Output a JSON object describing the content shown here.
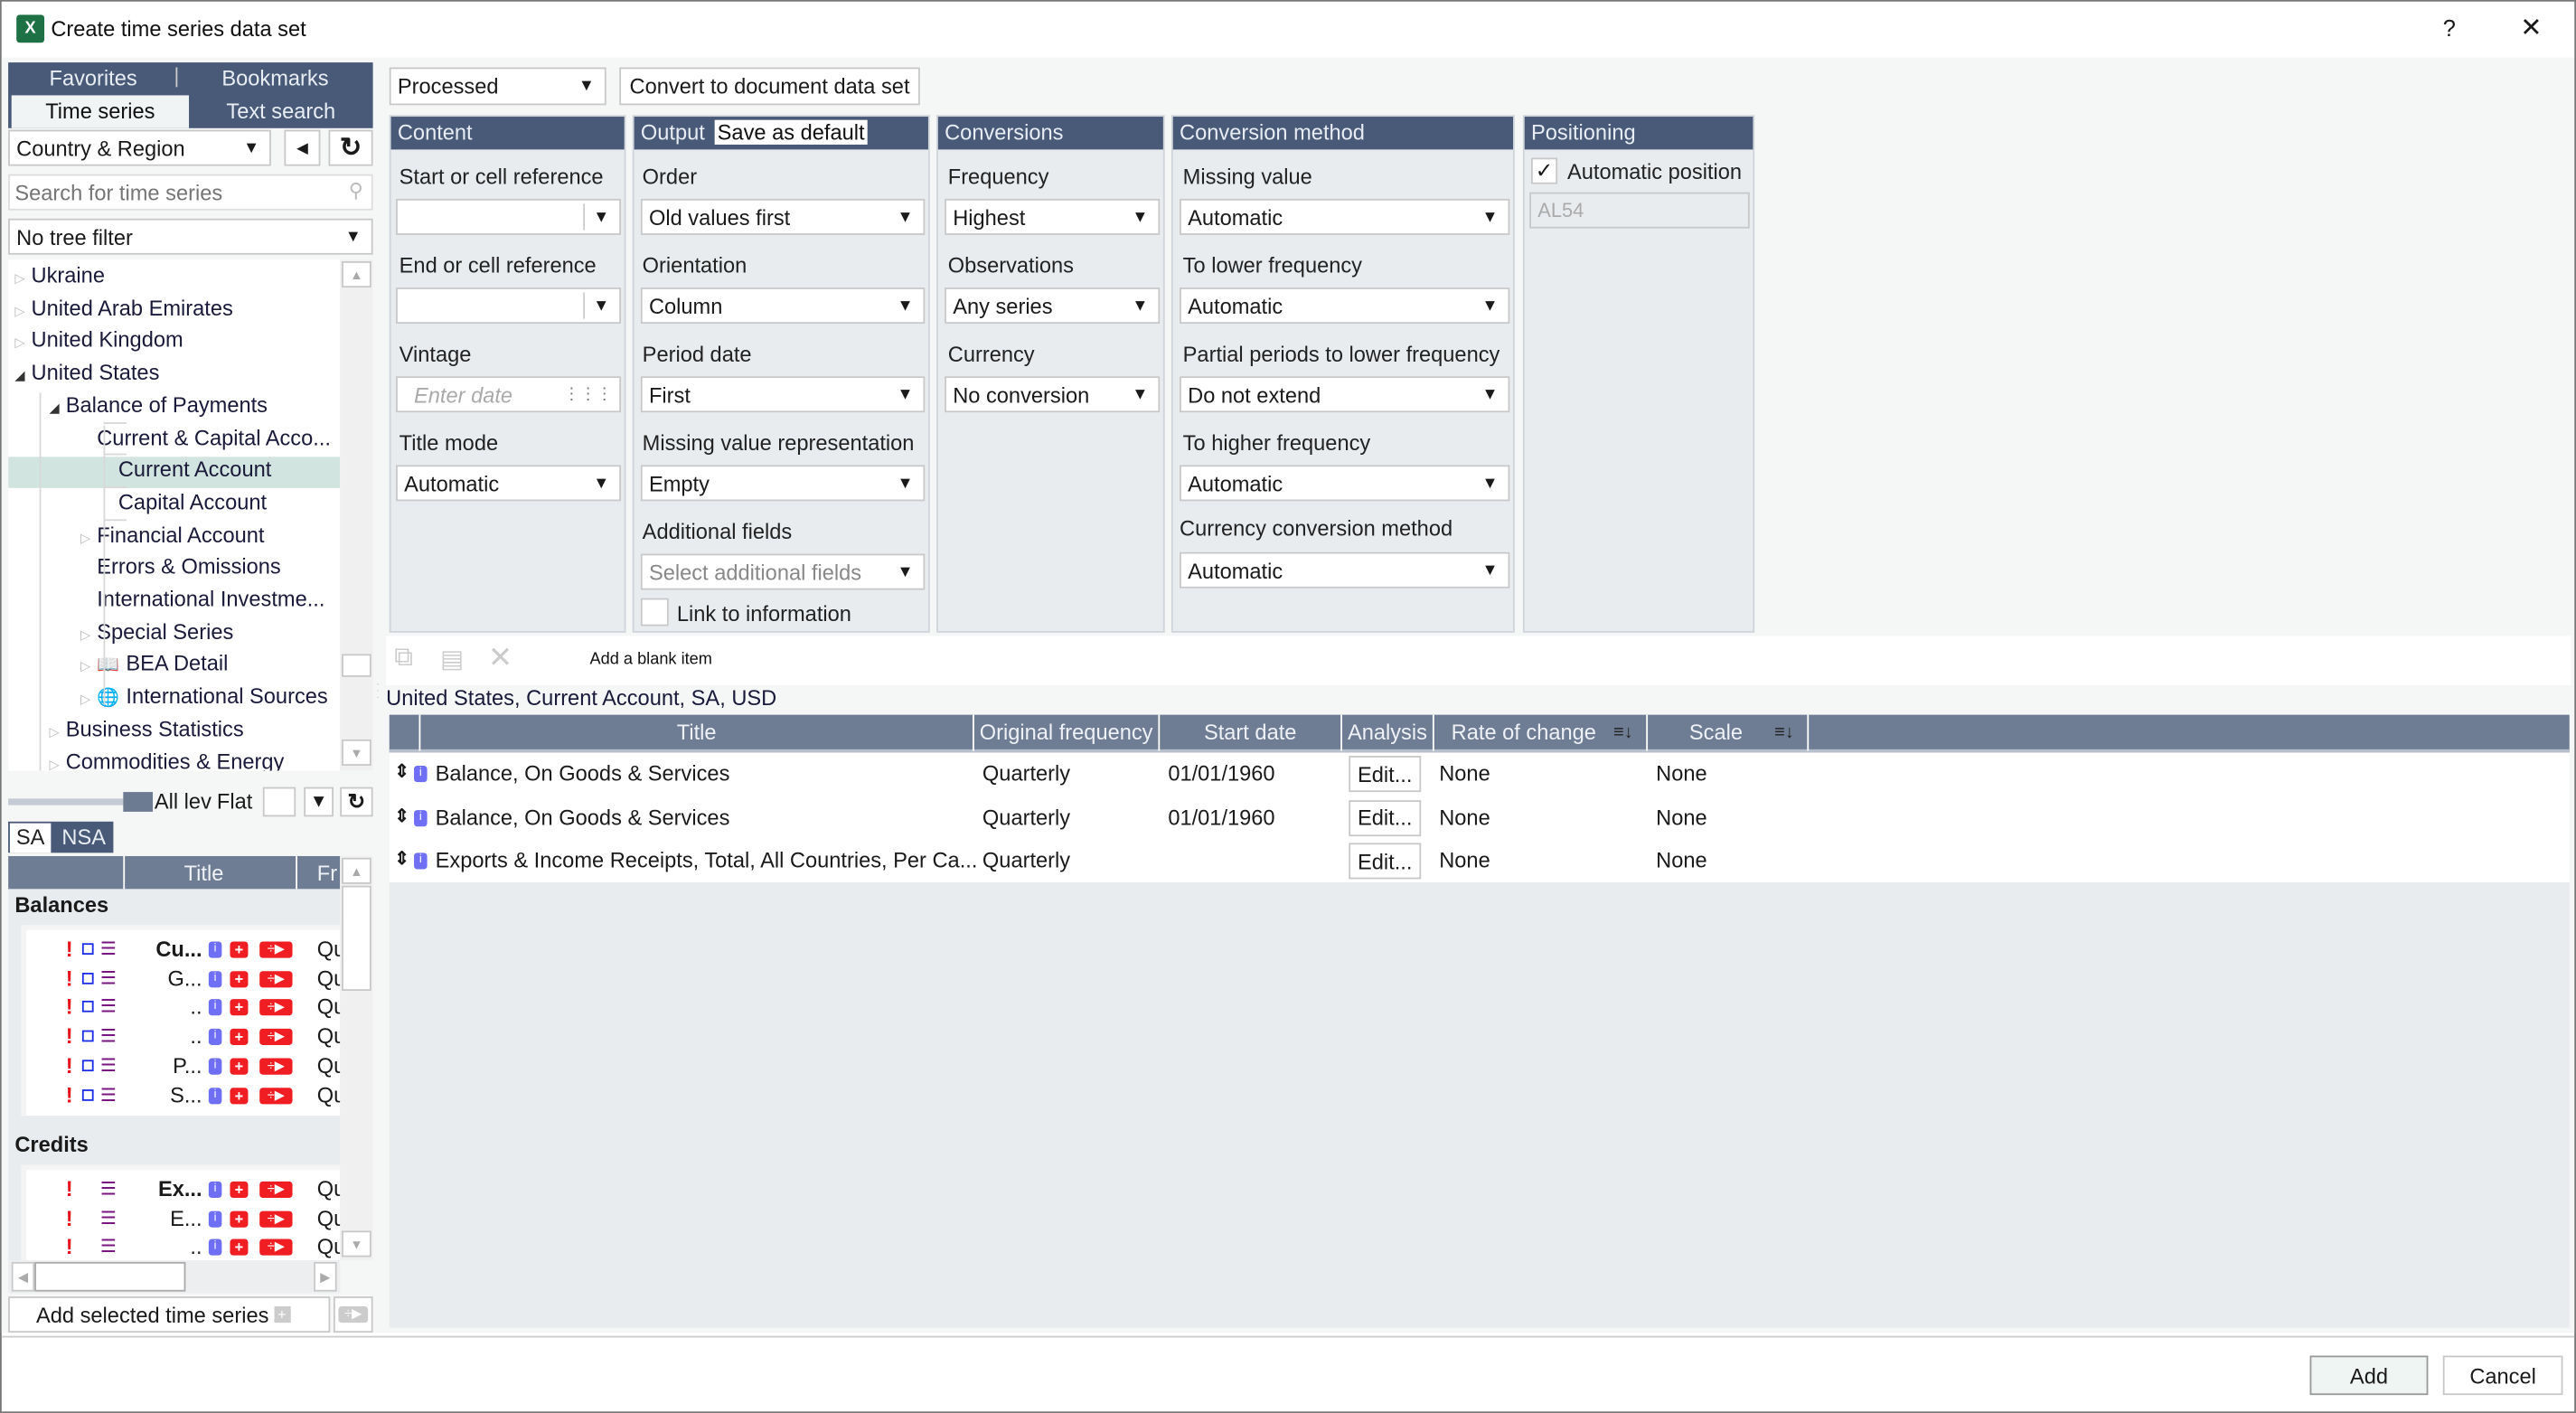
{
  "window": {
    "title": "Create time series data set",
    "app_icon": "excel-icon",
    "help_label": "?",
    "close_label": "✕"
  },
  "left": {
    "tabs_row1": [
      {
        "label": "Favorites"
      },
      {
        "label": "Bookmarks"
      }
    ],
    "tabs_row2": [
      {
        "label": "Time series",
        "active": true
      },
      {
        "label": "Text search",
        "active": false
      }
    ],
    "category_select": "Country & Region",
    "search_placeholder": "Search for time series",
    "tree_filter": "No tree filter",
    "tree": [
      {
        "label": "Ukraine",
        "level": 0,
        "expander": "collapsed"
      },
      {
        "label": "United Arab Emirates",
        "level": 0,
        "expander": "collapsed"
      },
      {
        "label": "United Kingdom",
        "level": 0,
        "expander": "collapsed"
      },
      {
        "label": "United States",
        "level": 0,
        "expander": "expanded"
      },
      {
        "label": "Balance of Payments",
        "level": 1,
        "expander": "expanded"
      },
      {
        "label": "Current & Capital Acco...",
        "level": 2,
        "expander": "none"
      },
      {
        "label": "Current Account",
        "level": 3,
        "expander": "none",
        "selected": true
      },
      {
        "label": "Capital Account",
        "level": 3,
        "expander": "none"
      },
      {
        "label": "Financial Account",
        "level": 2,
        "expander": "collapsed"
      },
      {
        "label": "Errors & Omissions",
        "level": 2,
        "expander": "none"
      },
      {
        "label": "International Investme...",
        "level": 2,
        "expander": "none"
      },
      {
        "label": "Special Series",
        "level": 2,
        "expander": "collapsed"
      },
      {
        "label": "BEA Detail",
        "level": 2,
        "expander": "collapsed",
        "icon": "book-icon"
      },
      {
        "label": "International Sources",
        "level": 2,
        "expander": "collapsed",
        "icon": "globe-icon"
      },
      {
        "label": "Business Statistics",
        "level": 1,
        "expander": "collapsed"
      },
      {
        "label": "Commodities & Energy",
        "level": 1,
        "expander": "collapsed"
      }
    ],
    "level_label": "All lev",
    "flat_label": "Flat",
    "sa_tabs": [
      {
        "label": "SA",
        "active": true
      },
      {
        "label": "NSA",
        "active": false
      }
    ],
    "series_header": {
      "title": "Title",
      "freq": "Fr"
    },
    "groups": [
      {
        "name": "Balances",
        "rows": [
          {
            "title": "Cu...",
            "bold": true,
            "freq": "Qu",
            "box": true
          },
          {
            "title": "G...",
            "freq": "Qu",
            "box": true
          },
          {
            "title": "..",
            "freq": "Qu",
            "box": true
          },
          {
            "title": "..",
            "freq": "Qu",
            "box": true
          },
          {
            "title": "P...",
            "freq": "Qu",
            "box": true
          },
          {
            "title": "S...",
            "freq": "Qu",
            "box": true
          }
        ]
      },
      {
        "name": "Credits",
        "rows": [
          {
            "title": "Ex...",
            "bold": true,
            "freq": "Qu",
            "box": false
          },
          {
            "title": "E...",
            "freq": "Qu",
            "box": false
          },
          {
            "title": "..",
            "freq": "Qu",
            "box": false
          }
        ]
      }
    ],
    "add_selected_label": "Add selected time series"
  },
  "toolbar": {
    "mode_select": "Processed",
    "convert_label": "Convert to document data set"
  },
  "panels": {
    "content": {
      "title": "Content",
      "start_label": "Start or cell reference",
      "start_value": "",
      "end_label": "End or cell reference",
      "end_value": "",
      "vintage_label": "Vintage",
      "vintage_placeholder": "Enter date",
      "title_mode_label": "Title mode",
      "title_mode_value": "Automatic"
    },
    "output": {
      "title": "Output",
      "save_default_label": "Save as default",
      "order_label": "Order",
      "order_value": "Old values first",
      "orientation_label": "Orientation",
      "orientation_value": "Column",
      "period_label": "Period date",
      "period_value": "First",
      "missing_label": "Missing value representation",
      "missing_value": "Empty",
      "additional_label": "Additional fields",
      "additional_placeholder": "Select additional fields",
      "link_label": "Link to information",
      "link_checked": false
    },
    "conversions": {
      "title": "Conversions",
      "frequency_label": "Frequency",
      "frequency_value": "Highest",
      "observations_label": "Observations",
      "observations_value": "Any series",
      "currency_label": "Currency",
      "currency_value": "No conversion"
    },
    "method": {
      "title": "Conversion method",
      "missing_label": "Missing value",
      "missing_value": "Automatic",
      "lower_label": "To lower frequency",
      "lower_value": "Automatic",
      "partial_label": "Partial periods to lower frequency",
      "partial_value": "Do not extend",
      "higher_label": "To higher frequency",
      "higher_value": "Automatic",
      "currency_method_label": "Currency conversion method",
      "currency_method_value": "Automatic"
    },
    "positioning": {
      "title": "Positioning",
      "auto_label": "Automatic position",
      "auto_checked": true,
      "cell_value": "AL54"
    }
  },
  "items": {
    "add_blank_label": "Add a blank item",
    "group_label": "United States, Current Account, SA, USD",
    "columns": [
      "Title",
      "Original frequency",
      "Start date",
      "Analysis",
      "Rate of change",
      "Scale"
    ],
    "rows": [
      {
        "title": "Balance, On Goods & Services",
        "freq": "Quarterly",
        "start": "01/01/1960",
        "analysis": "Edit...",
        "rate": "None",
        "scale": "None"
      },
      {
        "title": "Balance, On Goods & Services",
        "freq": "Quarterly",
        "start": "01/01/1960",
        "analysis": "Edit...",
        "rate": "None",
        "scale": "None"
      },
      {
        "title": "Exports & Income Receipts, Total, All Countries, Per Ca...",
        "freq": "Quarterly",
        "start": "",
        "analysis": "Edit...",
        "rate": "None",
        "scale": "None"
      }
    ]
  },
  "footer": {
    "add_label": "Add",
    "cancel_label": "Cancel"
  }
}
